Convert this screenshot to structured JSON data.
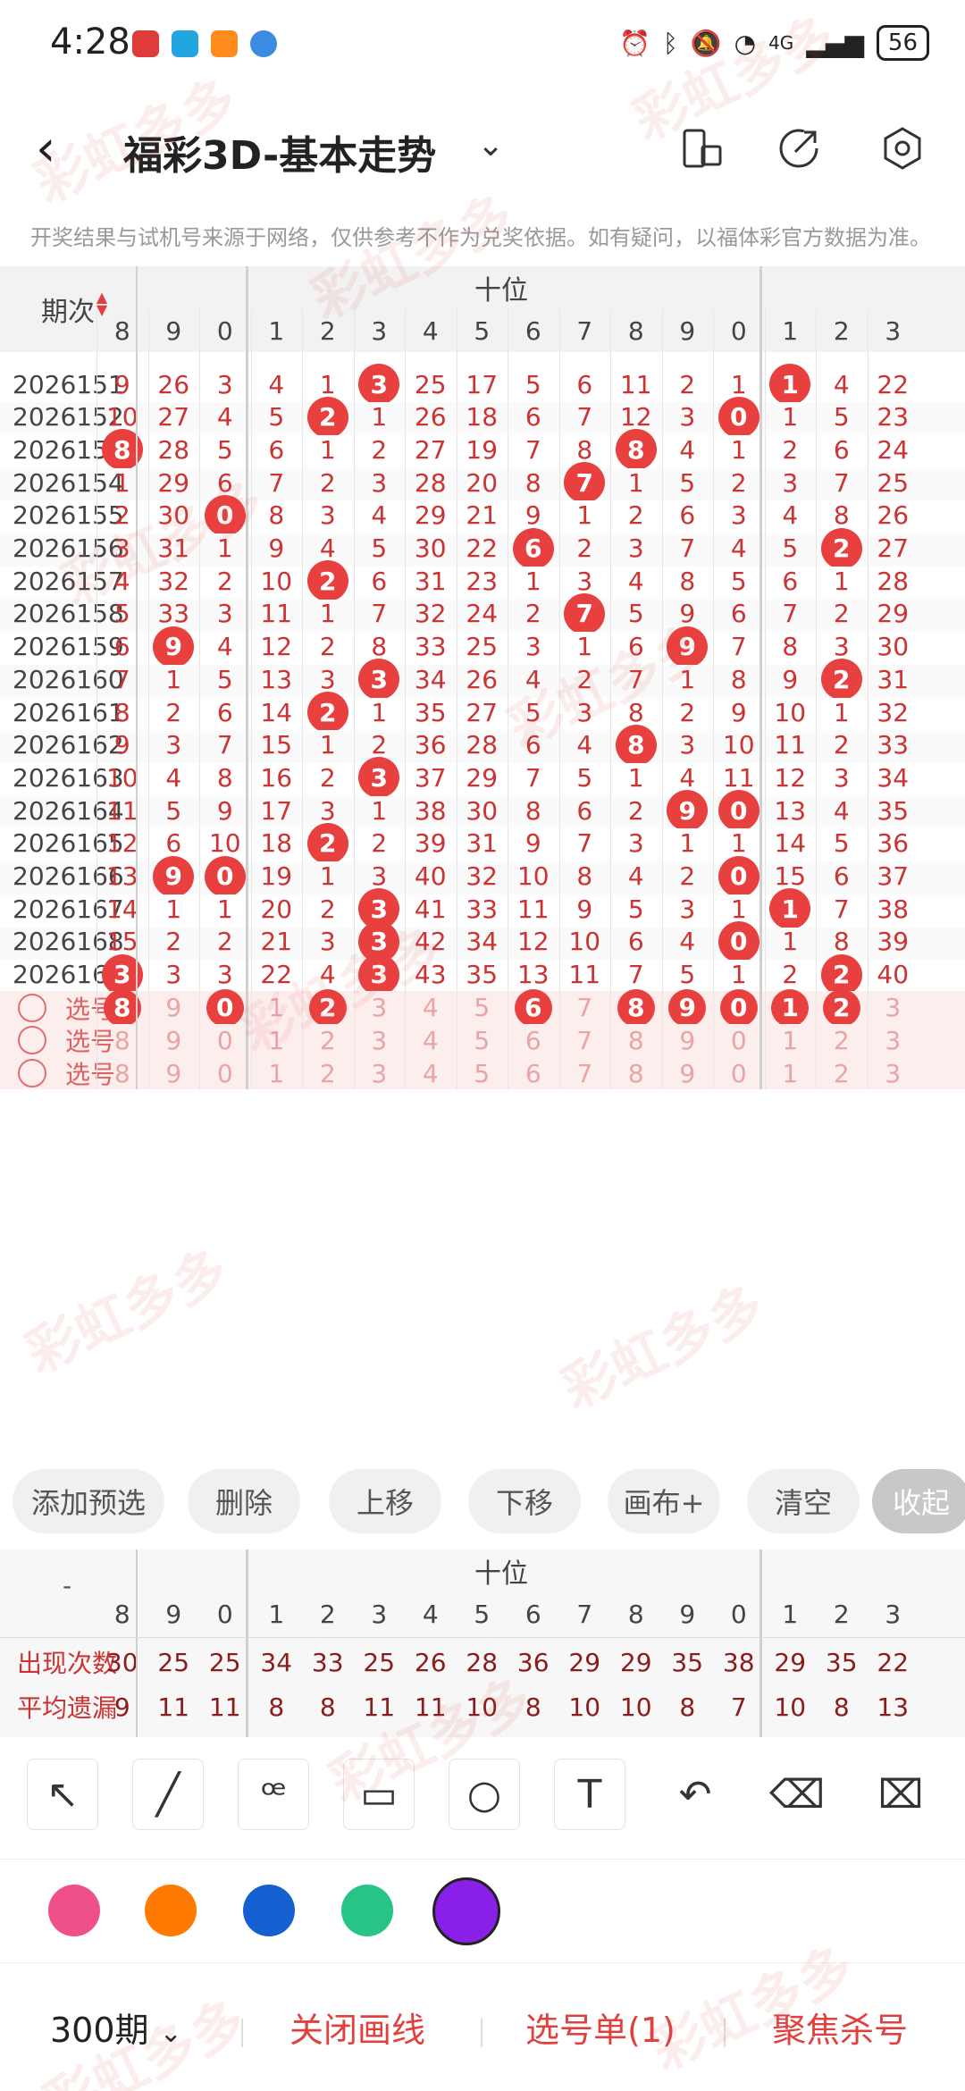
{
  "status": {
    "time": "4:28",
    "battery": "56",
    "net": "4G"
  },
  "header": {
    "title": "福彩3D-基本走势"
  },
  "notice": "开奖结果与试机号来源于网络，仅供参考不作为兑奖依据。如有疑问，以福体彩官方数据为准。",
  "table": {
    "period_label": "期次",
    "section_label": "十位",
    "col_headers": [
      "8",
      "9",
      "0",
      "1",
      "2",
      "3",
      "4",
      "5",
      "6",
      "7",
      "8",
      "9",
      "0",
      "1",
      "2",
      "3"
    ],
    "rows": [
      {
        "p": "2026151",
        "v": [
          "9",
          "26",
          "3",
          "4",
          "1",
          "3",
          "25",
          "17",
          "5",
          "6",
          "11",
          "2",
          "1",
          "1",
          "4",
          "22"
        ],
        "b": [
          5,
          13
        ]
      },
      {
        "p": "2026152",
        "v": [
          "10",
          "27",
          "4",
          "5",
          "2",
          "1",
          "26",
          "18",
          "6",
          "7",
          "12",
          "3",
          "0",
          "1",
          "5",
          "23"
        ],
        "b": [
          4,
          12
        ]
      },
      {
        "p": "2026153",
        "v": [
          "8",
          "28",
          "5",
          "6",
          "1",
          "2",
          "27",
          "19",
          "7",
          "8",
          "8",
          "4",
          "1",
          "2",
          "6",
          "24"
        ],
        "b": [
          0,
          10
        ]
      },
      {
        "p": "2026154",
        "v": [
          "1",
          "29",
          "6",
          "7",
          "2",
          "3",
          "28",
          "20",
          "8",
          "7",
          "1",
          "5",
          "2",
          "3",
          "7",
          "25"
        ],
        "b": [
          9
        ]
      },
      {
        "p": "2026155",
        "v": [
          "2",
          "30",
          "0",
          "8",
          "3",
          "4",
          "29",
          "21",
          "9",
          "1",
          "2",
          "6",
          "3",
          "4",
          "8",
          "26"
        ],
        "b": [
          2
        ]
      },
      {
        "p": "2026156",
        "v": [
          "3",
          "31",
          "1",
          "9",
          "4",
          "5",
          "30",
          "22",
          "6",
          "2",
          "3",
          "7",
          "4",
          "5",
          "2",
          "27"
        ],
        "b": [
          8,
          14
        ]
      },
      {
        "p": "2026157",
        "v": [
          "4",
          "32",
          "2",
          "10",
          "2",
          "6",
          "31",
          "23",
          "1",
          "3",
          "4",
          "8",
          "5",
          "6",
          "1",
          "28"
        ],
        "b": [
          4
        ]
      },
      {
        "p": "2026158",
        "v": [
          "5",
          "33",
          "3",
          "11",
          "1",
          "7",
          "32",
          "24",
          "2",
          "7",
          "5",
          "9",
          "6",
          "7",
          "2",
          "29"
        ],
        "b": [
          9
        ]
      },
      {
        "p": "2026159",
        "v": [
          "6",
          "9",
          "4",
          "12",
          "2",
          "8",
          "33",
          "25",
          "3",
          "1",
          "6",
          "9",
          "7",
          "8",
          "3",
          "30"
        ],
        "b": [
          1,
          11
        ]
      },
      {
        "p": "2026160",
        "v": [
          "7",
          "1",
          "5",
          "13",
          "3",
          "3",
          "34",
          "26",
          "4",
          "2",
          "7",
          "1",
          "8",
          "9",
          "2",
          "31"
        ],
        "b": [
          5,
          14
        ]
      },
      {
        "p": "2026161",
        "v": [
          "8",
          "2",
          "6",
          "14",
          "2",
          "1",
          "35",
          "27",
          "5",
          "3",
          "8",
          "2",
          "9",
          "10",
          "1",
          "32"
        ],
        "b": [
          4
        ]
      },
      {
        "p": "2026162",
        "v": [
          "9",
          "3",
          "7",
          "15",
          "1",
          "2",
          "36",
          "28",
          "6",
          "4",
          "8",
          "3",
          "10",
          "11",
          "2",
          "33"
        ],
        "b": [
          10
        ]
      },
      {
        "p": "2026163",
        "v": [
          "10",
          "4",
          "8",
          "16",
          "2",
          "3",
          "37",
          "29",
          "7",
          "5",
          "1",
          "4",
          "11",
          "12",
          "3",
          "34"
        ],
        "b": [
          5
        ]
      },
      {
        "p": "2026164",
        "v": [
          "11",
          "5",
          "9",
          "17",
          "3",
          "1",
          "38",
          "30",
          "8",
          "6",
          "2",
          "9",
          "0",
          "13",
          "4",
          "35"
        ],
        "b": [
          11,
          12
        ]
      },
      {
        "p": "2026165",
        "v": [
          "12",
          "6",
          "10",
          "18",
          "2",
          "2",
          "39",
          "31",
          "9",
          "7",
          "3",
          "1",
          "1",
          "14",
          "5",
          "36"
        ],
        "b": [
          4
        ]
      },
      {
        "p": "2026166",
        "v": [
          "13",
          "9",
          "0",
          "19",
          "1",
          "3",
          "40",
          "32",
          "10",
          "8",
          "4",
          "2",
          "0",
          "15",
          "6",
          "37"
        ],
        "b": [
          1,
          2,
          12
        ]
      },
      {
        "p": "2026167",
        "v": [
          "14",
          "1",
          "1",
          "20",
          "2",
          "3",
          "41",
          "33",
          "11",
          "9",
          "5",
          "3",
          "1",
          "1",
          "7",
          "38"
        ],
        "b": [
          5,
          13
        ]
      },
      {
        "p": "2026168",
        "v": [
          "15",
          "2",
          "2",
          "21",
          "3",
          "3",
          "42",
          "34",
          "12",
          "10",
          "6",
          "4",
          "0",
          "1",
          "8",
          "39"
        ],
        "b": [
          5,
          12
        ]
      },
      {
        "p": "2026169",
        "v": [
          "3",
          "3",
          "3",
          "22",
          "4",
          "3",
          "43",
          "35",
          "13",
          "11",
          "7",
          "5",
          "1",
          "2",
          "2",
          "40"
        ],
        "b": [
          0,
          5,
          14
        ]
      }
    ],
    "pick_label": "选号",
    "pick_selected": [
      0,
      2,
      4,
      8,
      10,
      11,
      12,
      13,
      14
    ],
    "pick_values": [
      "8",
      "9",
      "0",
      "1",
      "2",
      "3",
      "4",
      "5",
      "6",
      "7",
      "8",
      "9",
      "0",
      "1",
      "2",
      "3"
    ]
  },
  "actions": [
    "添加预选",
    "删除",
    "上移",
    "下移",
    "画布+",
    "清空",
    "收起"
  ],
  "stats": {
    "dash": "-",
    "section_label": "十位",
    "col_headers": [
      "8",
      "9",
      "0",
      "1",
      "2",
      "3",
      "4",
      "5",
      "6",
      "7",
      "8",
      "9",
      "0",
      "1",
      "2",
      "3"
    ],
    "row1_label": "出现次数",
    "row1": [
      "30",
      "25",
      "25",
      "34",
      "33",
      "25",
      "26",
      "28",
      "36",
      "29",
      "29",
      "35",
      "38",
      "29",
      "35",
      "22"
    ],
    "row2_label": "平均遗漏",
    "row2": [
      "9",
      "11",
      "11",
      "8",
      "8",
      "11",
      "11",
      "10",
      "8",
      "10",
      "10",
      "8",
      "7",
      "10",
      "8",
      "13"
    ]
  },
  "draw_tools": [
    "pointer-arrow-icon",
    "line-icon",
    "curve-icon",
    "rectangle-icon",
    "circle-icon",
    "text-icon",
    "undo-icon",
    "eraser-icon",
    "clear-brush-icon"
  ],
  "colors": [
    "#f0508a",
    "#ff7a00",
    "#1560d0",
    "#27c486",
    "#8a1fe8"
  ],
  "bottom": {
    "periods": "300期",
    "close_line": "关闭画线",
    "pick_list": "选号单(1)",
    "focus_kill": "聚焦杀号"
  },
  "watermark": "彩虹多多"
}
